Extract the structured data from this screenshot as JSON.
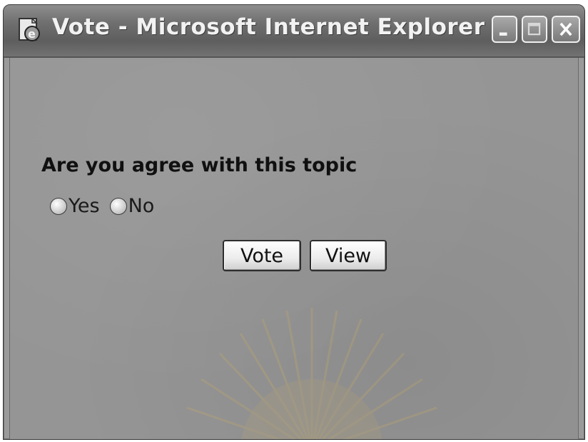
{
  "window": {
    "title": "Vote - Microsoft Internet Explorer",
    "icon": "ie-page-icon",
    "controls": [
      "minimize-icon",
      "maximize-icon",
      "close-icon"
    ]
  },
  "form": {
    "question": "Are you agree with this topic",
    "options": [
      {
        "label": "Yes",
        "selected": false
      },
      {
        "label": "No",
        "selected": false
      }
    ],
    "buttons": {
      "vote_label": "Vote",
      "view_label": "View"
    }
  },
  "colors": {
    "titlebar": "#6f6f6f",
    "content_background": "#959595",
    "text": "#101010"
  }
}
